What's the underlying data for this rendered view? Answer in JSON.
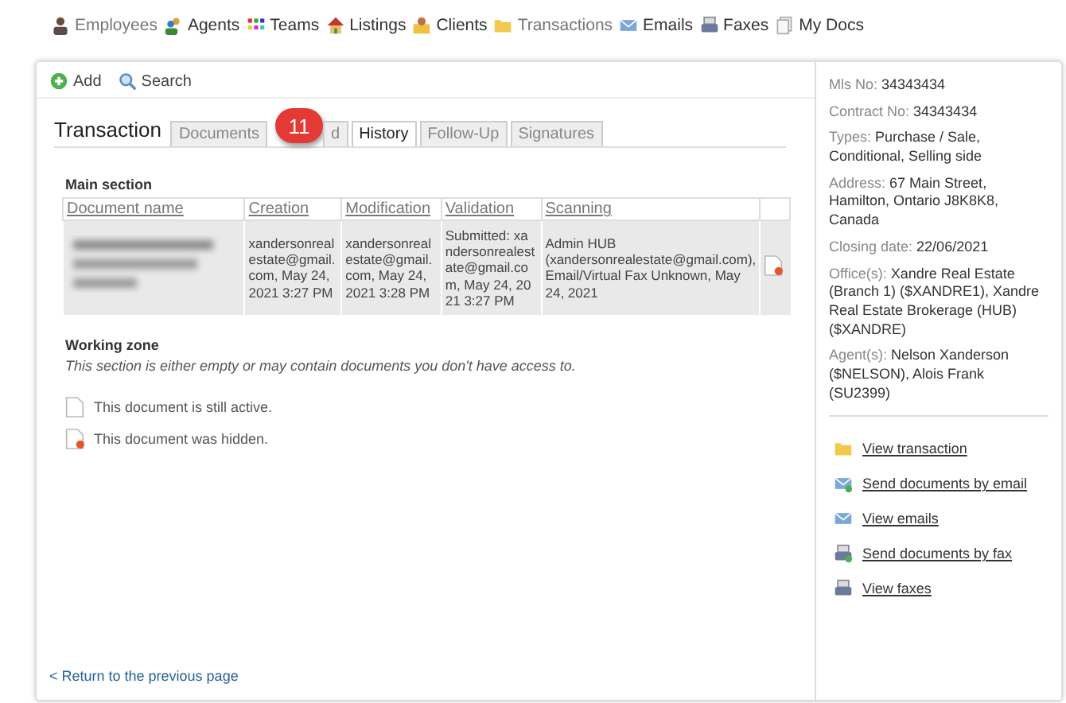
{
  "nav": [
    {
      "label": "Employees",
      "kind": "person"
    },
    {
      "label": "Agents",
      "kind": "agents"
    },
    {
      "label": "Teams",
      "kind": "teams"
    },
    {
      "label": "Listings",
      "kind": "house"
    },
    {
      "label": "Clients",
      "kind": "clients"
    },
    {
      "label": "Transactions",
      "kind": "folder"
    },
    {
      "label": "Emails",
      "kind": "email"
    },
    {
      "label": "Faxes",
      "kind": "fax"
    },
    {
      "label": "My Docs",
      "kind": "docs"
    }
  ],
  "toolbar": [
    {
      "label": "Add",
      "kind": "add"
    },
    {
      "label": "Search",
      "kind": "search"
    }
  ],
  "section_title": "Transaction",
  "tabs": [
    {
      "label": "Documents",
      "selected": false
    },
    {
      "label": "d",
      "selected": false
    },
    {
      "label": "History",
      "selected": true
    },
    {
      "label": "Follow-Up",
      "selected": false
    },
    {
      "label": "Signatures",
      "selected": false
    }
  ],
  "callout": {
    "text": "11"
  },
  "main_section": {
    "title": "Main section",
    "columns": [
      "Document name",
      "Creation",
      "Modification",
      "Validation",
      "Scanning"
    ],
    "rows": [
      {
        "creation": "xandersonreal estate@gmail. com, May 24, 2021 3:27 PM",
        "modification": "xandersonreal estate@gmail. com, May 24, 2021 3:28 PM",
        "validation": "Submitted: xa ndersonrealest ate@gmail.co m, May 24, 20 21 3:27 PM",
        "scanning": "Admin HUB (xandersonrealestate@gmail.com), Email/Virtual Fax Unknown, May 24, 2021",
        "hidden": true
      }
    ]
  },
  "working_zone": {
    "title": "Working zone",
    "note": "This section is either empty or may contain documents you don't have access to."
  },
  "legend": [
    {
      "text": "This document is still active.",
      "hidden": false
    },
    {
      "text": "This document was hidden.",
      "hidden": true
    }
  ],
  "back_link": "< Return to the previous page",
  "details": [
    {
      "label": "Mls No:",
      "value": "34343434"
    },
    {
      "label": "Contract No:",
      "value": "34343434"
    },
    {
      "label": "Types:",
      "value": "Purchase / Sale, Conditional, Selling side"
    },
    {
      "label": "Address:",
      "value": "67 Main Street, Hamilton, Ontario J8K8K8, Canada"
    },
    {
      "label": "Closing date:",
      "value": "22/06/2021"
    },
    {
      "label": "Office(s):",
      "value": "Xandre Real Estate (Branch 1) ($XANDRE1), Xandre Real Estate Brokerage (HUB) ($XANDRE)"
    },
    {
      "label": "Agent(s):",
      "value": "Nelson Xanderson ($NELSON), Alois Frank (SU2399)"
    }
  ],
  "actions": [
    {
      "label": "View transaction",
      "kind": "folder"
    },
    {
      "label": "Send documents by email",
      "kind": "send-email"
    },
    {
      "label": "View emails",
      "kind": "email"
    },
    {
      "label": "Send documents by fax",
      "kind": "send-fax"
    },
    {
      "label": "View faxes",
      "kind": "fax"
    }
  ]
}
